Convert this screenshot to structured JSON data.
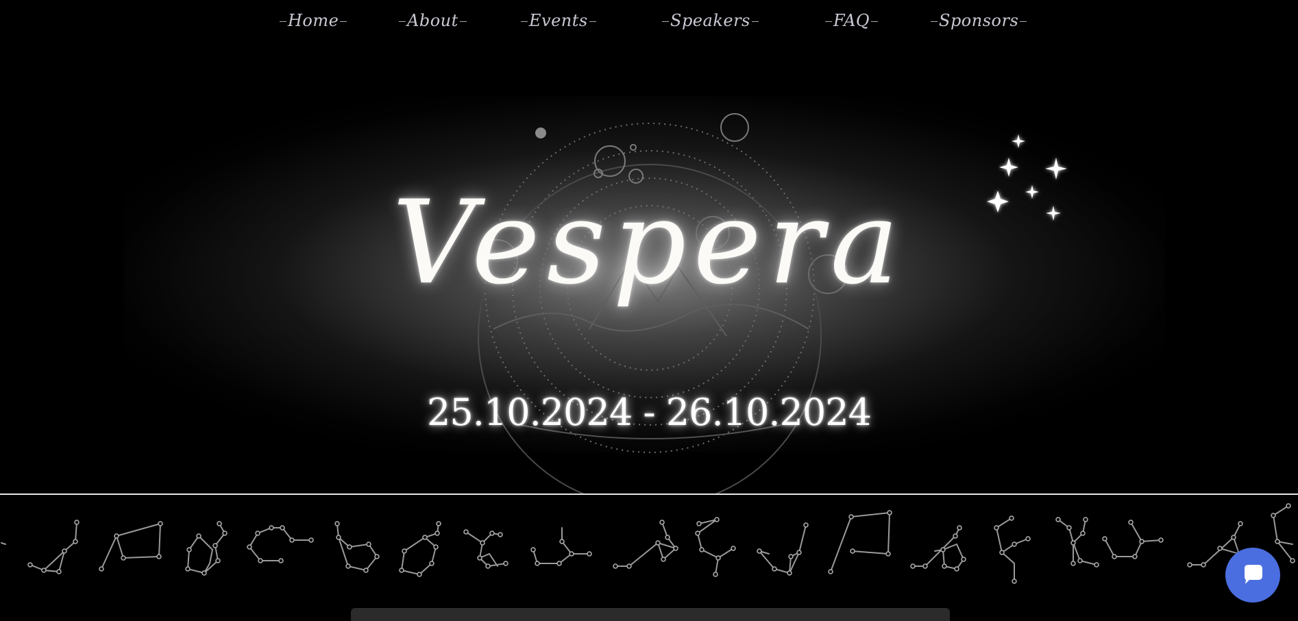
{
  "nav": {
    "items": [
      {
        "label": "Home"
      },
      {
        "label": "About"
      },
      {
        "label": "Events"
      },
      {
        "label": "Speakers"
      },
      {
        "label": "FAQ"
      },
      {
        "label": "Sponsors"
      }
    ]
  },
  "hero": {
    "title": "Vespera",
    "dates": "25.10.2024 - 26.10.2024"
  },
  "icons": {
    "sparkles": "sparkles-icon",
    "emblem": "celestial-emblem-icon",
    "constellations": "constellation-icons",
    "chat": "chat-bubble-icon"
  },
  "colors": {
    "background": "#000000",
    "text": "#ffffff",
    "nav_text": "#c9c9d4",
    "chat_button": "#4a6ee0",
    "divider": "#e8e8e8"
  }
}
